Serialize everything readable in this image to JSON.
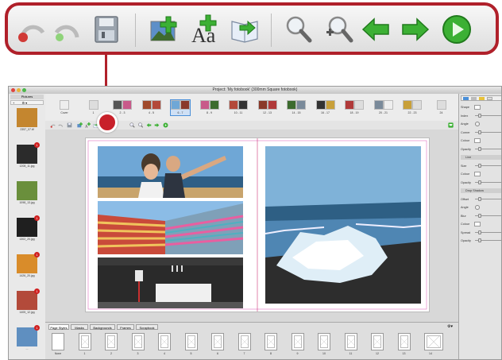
{
  "toolbar_callout": {
    "icons": [
      "undo-icon",
      "redo-icon",
      "save-icon",
      "add-picture-icon",
      "add-text-icon",
      "add-page-icon",
      "zoom-out-icon",
      "zoom-in-icon",
      "previous-page-icon",
      "next-page-icon",
      "preview-play-icon"
    ]
  },
  "window": {
    "title": "Project: 'My fotobook' (300mm Square fotobook)"
  },
  "pictures_panel": {
    "header": "Pictures",
    "add_button": "+",
    "gear_button": "⚙ ▾",
    "items": [
      {
        "label": "2357_07.tif",
        "badge": ""
      },
      {
        "label": "1208_11.jpg",
        "badge": "1"
      },
      {
        "label": "1098_13.jpg",
        "badge": ""
      },
      {
        "label": "1302_20.jpg",
        "badge": "1"
      },
      {
        "label": "1426_20.jpg",
        "badge": "1"
      },
      {
        "label": "1405_12.jpg",
        "badge": "1"
      },
      {
        "label": "...",
        "badge": "1"
      }
    ]
  },
  "spreads_strip": {
    "items": [
      "Cover",
      "1",
      "2 - 3",
      "4 - 5",
      "6 - 7",
      "8 - 9",
      "10 - 11",
      "12 - 13",
      "14 - 15",
      "16 - 17",
      "18 - 19",
      "20 - 21",
      "22 - 23",
      "24"
    ],
    "selected_index": 4
  },
  "bottom_panel": {
    "tabs": [
      "Page Styles",
      "Masks",
      "Backgrounds",
      "Frames",
      "Scrapbook"
    ],
    "active_tab": 0,
    "layouts": [
      "None",
      "1",
      "2",
      "3",
      "4",
      "5",
      "6",
      "7",
      "8",
      "9",
      "10",
      "11",
      "12",
      "13",
      "14"
    ]
  },
  "properties": {
    "tabs": [
      "layers",
      "text",
      "ruler",
      "page"
    ],
    "rows": [
      {
        "label": "Shape",
        "kind": "swatch"
      },
      {
        "label": "Index",
        "kind": "slider"
      },
      {
        "label": "Angle",
        "kind": "dial"
      },
      {
        "label": "Corner",
        "kind": "slider"
      },
      {
        "label": "Colour",
        "kind": "swatch"
      },
      {
        "label": "Opacity",
        "kind": "slider"
      },
      {
        "label": "Line",
        "kind": "header"
      },
      {
        "label": "Size",
        "kind": "slider"
      },
      {
        "label": "Colour",
        "kind": "swatch"
      },
      {
        "label": "Opacity",
        "kind": "slider"
      },
      {
        "label": "Drop Shadow",
        "kind": "header"
      },
      {
        "label": "Offset",
        "kind": "slider"
      },
      {
        "label": "Angle",
        "kind": "dial"
      },
      {
        "label": "Blur",
        "kind": "slider"
      },
      {
        "label": "Colour",
        "kind": "swatch"
      },
      {
        "label": "Spread",
        "kind": "slider"
      },
      {
        "label": "Opacity",
        "kind": "slider"
      }
    ]
  },
  "colors": {
    "callout_border": "#b0202a",
    "green_arrow": "#3cb034",
    "selected_spread": "#4a8fd8"
  }
}
